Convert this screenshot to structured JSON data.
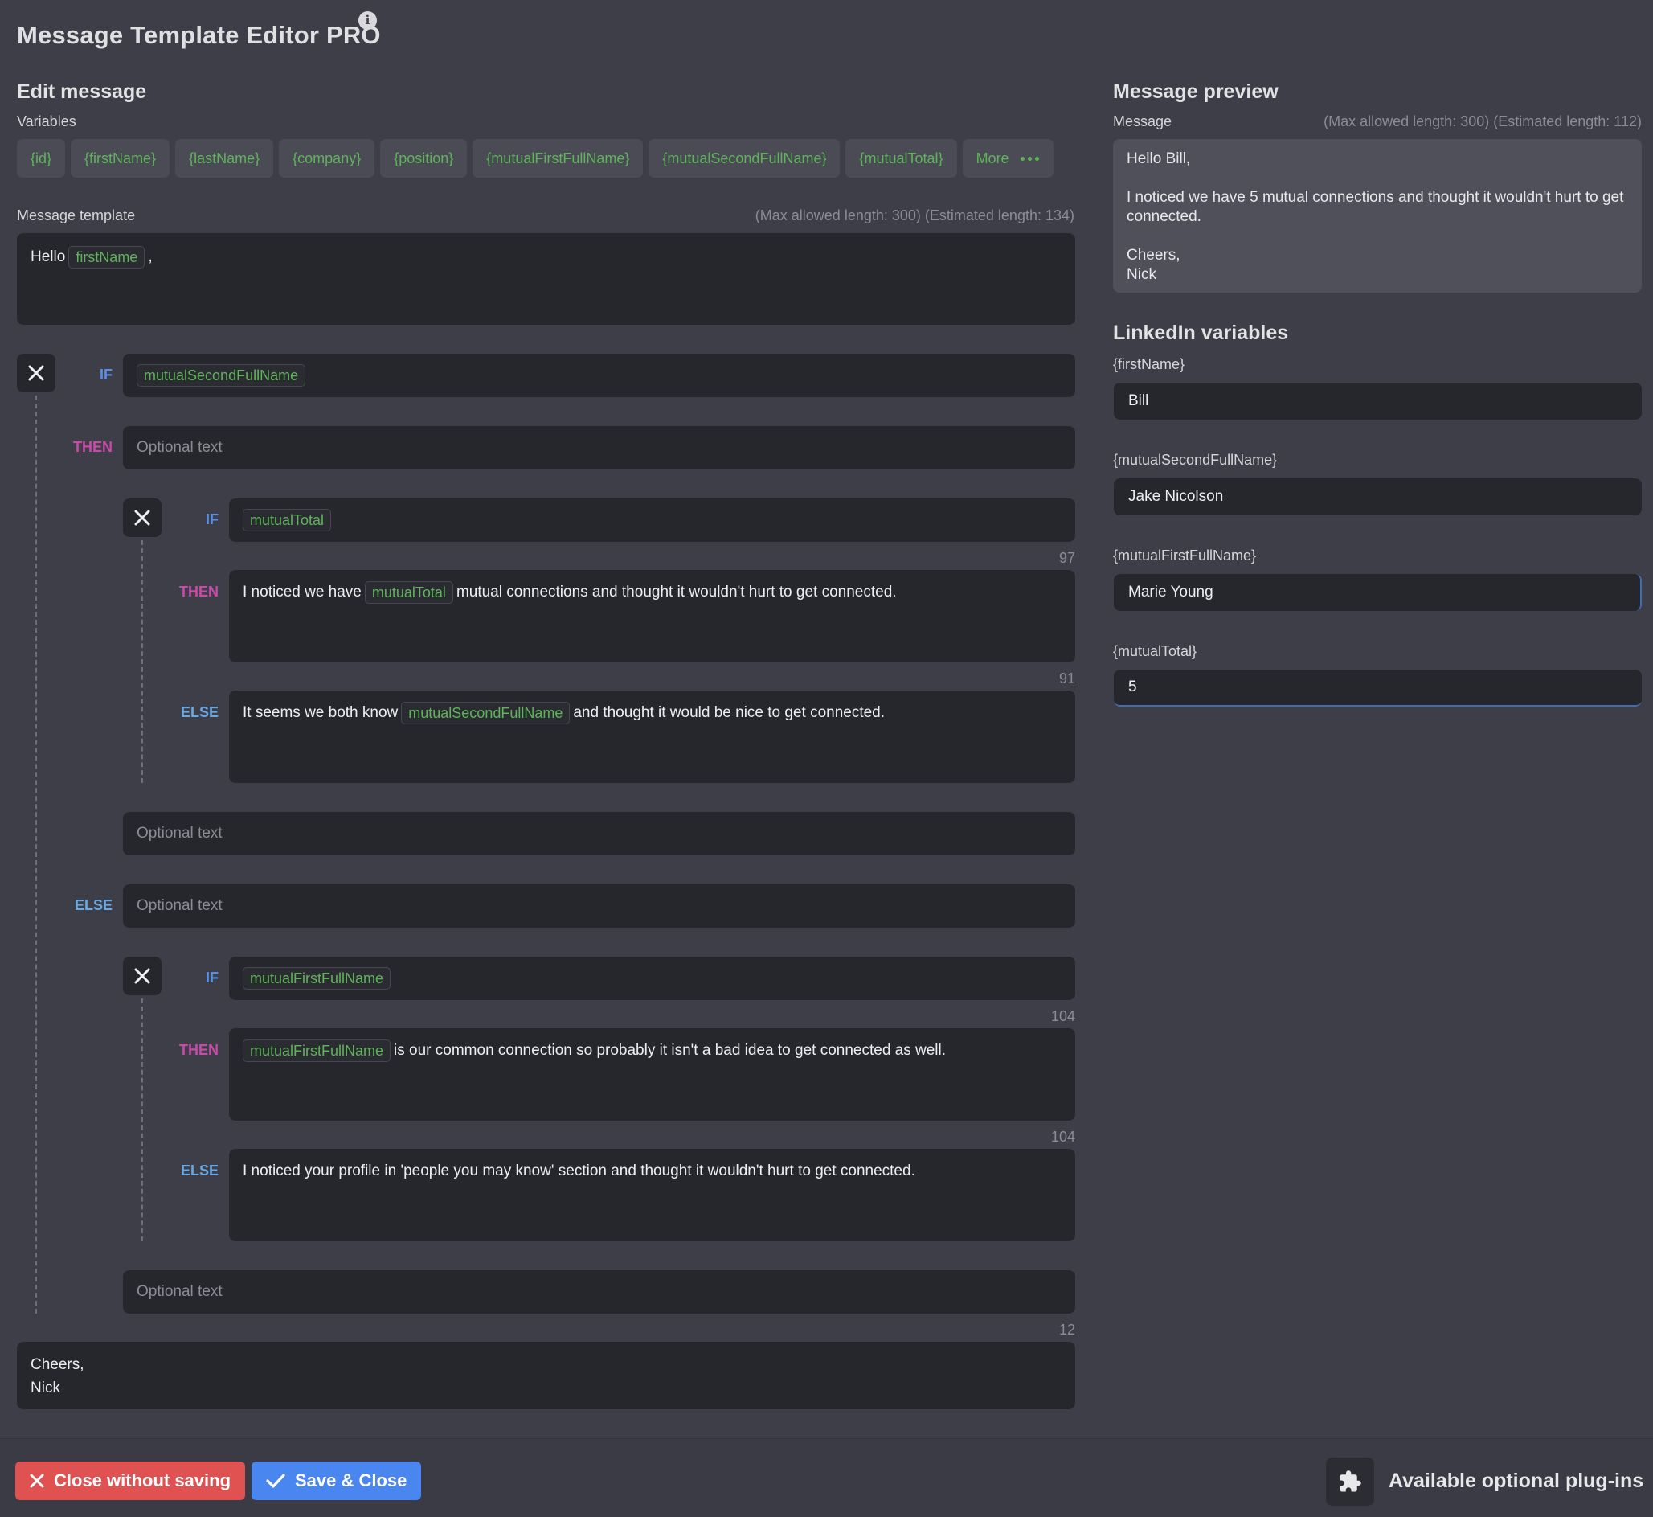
{
  "app": {
    "title": "Message Template Editor PRO",
    "info_icon": "info-icon"
  },
  "edit": {
    "title": "Edit message",
    "variables_label": "Variables",
    "variables": [
      "{id}",
      "{firstName}",
      "{lastName}",
      "{company}",
      "{position}",
      "{mutualFirstFullName}",
      "{mutualSecondFullName}",
      "{mutualTotal}"
    ],
    "more_label": "More",
    "template_label": "Message template",
    "template_length": "(Max allowed length: 300) (Estimated length: 134)",
    "greeting_before": "Hello",
    "greeting_var": "firstName",
    "greeting_after": ",",
    "if1": {
      "if_kw": "IF",
      "condition": "mutualSecondFullName",
      "then_kw": "THEN",
      "then_placeholder": "Optional text",
      "nested": {
        "if_kw": "IF",
        "condition": "mutualTotal",
        "then_kw": "THEN",
        "then_count": "97",
        "then_text_before": "I noticed we have",
        "then_var": "mutualTotal",
        "then_text_after": "mutual connections and thought it wouldn't hurt to get connected.",
        "else_kw": "ELSE",
        "else_count": "91",
        "else_text_before": "It seems we both know",
        "else_var": "mutualSecondFullName",
        "else_text_after": "and thought it would be nice to get connected."
      },
      "after_then_placeholder": "Optional text",
      "else_kw": "ELSE",
      "else_placeholder": "Optional text",
      "nested2": {
        "if_kw": "IF",
        "condition": "mutualFirstFullName",
        "then_kw": "THEN",
        "then_count": "104",
        "then_var": "mutualFirstFullName",
        "then_text_after": "is our common connection so probably it isn't a bad idea to get connected as well.",
        "else_kw": "ELSE",
        "else_count": "104",
        "else_text": "I noticed your profile in 'people you may know' section and thought it wouldn't hurt to get connected."
      },
      "after_else_placeholder": "Optional text"
    },
    "closing_count": "12",
    "closing_line1": "Cheers,",
    "closing_line2": "Nick"
  },
  "preview": {
    "title": "Message preview",
    "message_label": "Message",
    "length": "(Max allowed length: 300) (Estimated length: 112)",
    "line1": "Hello Bill,",
    "line2": "I noticed we have 5 mutual connections and thought it wouldn't hurt to get connected.",
    "line3": "Cheers,",
    "line4": "Nick"
  },
  "linkedin": {
    "title": "LinkedIn variables",
    "fields": [
      {
        "label": "{firstName}",
        "value": "Bill"
      },
      {
        "label": "{mutualSecondFullName}",
        "value": "Jake Nicolson"
      },
      {
        "label": "{mutualFirstFullName}",
        "value": "Marie Young"
      },
      {
        "label": "{mutualTotal}",
        "value": "5"
      }
    ]
  },
  "footer": {
    "close_label": "Close without saving",
    "save_label": "Save & Close",
    "plugins_label": "Available optional plug-ins"
  },
  "colors": {
    "accent_green": "#5fb35b",
    "if_blue": "#5b8fe6",
    "then_magenta": "#c94aa8",
    "danger": "#e05252",
    "primary": "#4a86ef"
  }
}
